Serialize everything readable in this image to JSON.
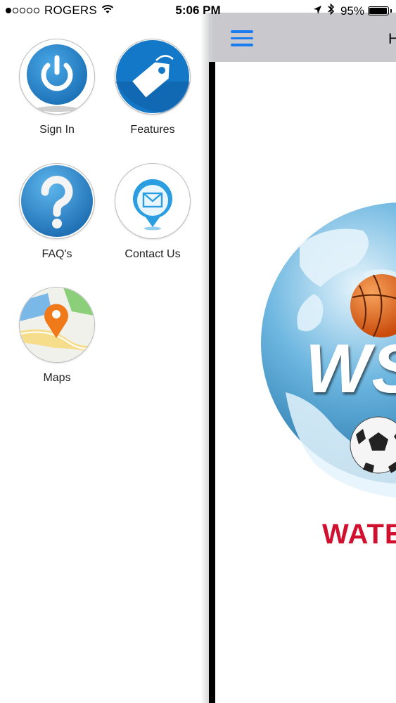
{
  "status_bar": {
    "carrier": "ROGERS",
    "signal_bars_filled": 1,
    "signal_bars_total": 5,
    "time": "5:06 PM",
    "battery_percent": "95%",
    "battery_level": 0.95,
    "icons": [
      "wifi-icon",
      "location-arrow-icon",
      "bluetooth-icon",
      "battery-icon"
    ]
  },
  "side_menu": {
    "items": [
      {
        "label": "Sign In",
        "icon": "power-icon"
      },
      {
        "label": "Features",
        "icon": "price-tag-icon"
      },
      {
        "label": "FAQ's",
        "icon": "question-mark-icon"
      },
      {
        "label": "Contact Us",
        "icon": "envelope-pin-icon"
      },
      {
        "label": "Maps",
        "icon": "map-pin-icon"
      }
    ]
  },
  "nav_bar": {
    "title": "H",
    "menu_icon": "hamburger-menu-icon"
  },
  "main": {
    "logo_letters": "WS",
    "brand_text": "WATE"
  },
  "colors": {
    "accent_blue": "#1a7cf0",
    "brand_red": "#d0102e",
    "nav_bar_gray": "#c9c8cd",
    "icon_blue": "#1e88d2",
    "map_orange": "#f07a1a"
  }
}
